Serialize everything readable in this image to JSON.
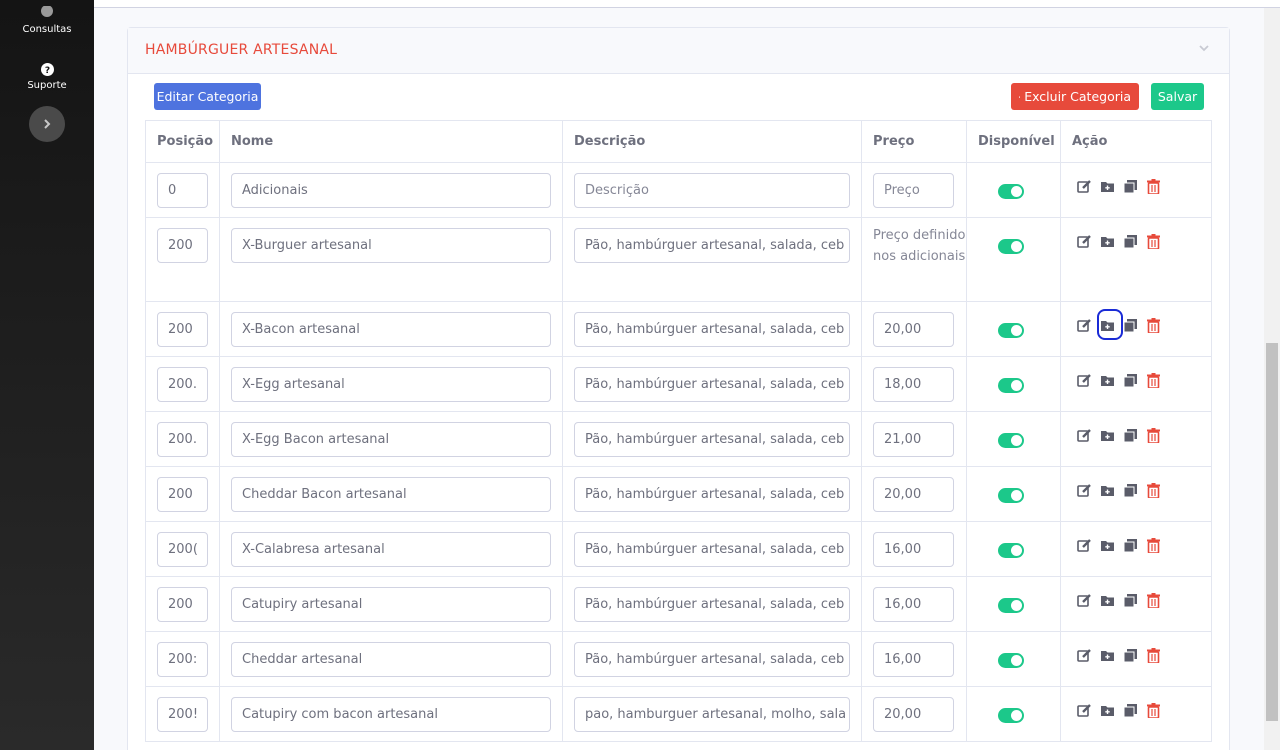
{
  "sidebar": {
    "items": [
      {
        "label": "Consultas",
        "icon": "chart-pie-icon"
      },
      {
        "label": "Suporte",
        "icon": "question-circle-icon"
      }
    ],
    "toggle_icon": "chevron-right-icon"
  },
  "category": {
    "title": "HAMBÚRGUER ARTESANAL",
    "collapse_icon": "chevron-down-icon",
    "edit_label": "Editar Categoria",
    "delete_label": "Excluir Categoria",
    "save_label": "Salvar"
  },
  "table": {
    "headers": [
      "Posição",
      "Nome",
      "Descrição",
      "Preço",
      "Disponível",
      "Ação"
    ],
    "rows": [
      {
        "position": "0",
        "name": "Adicionais",
        "description": "",
        "description_placeholder": "Descrição",
        "price": "",
        "price_placeholder": "Preço",
        "available": true
      },
      {
        "position": "200",
        "name": "X-Burguer artesanal",
        "description": "Pão, hambúrguer artesanal, salada, ceb",
        "price_text": "Preço definido nos adicionais",
        "available": true
      },
      {
        "position": "200",
        "name": "X-Bacon artesanal",
        "description": "Pão, hambúrguer artesanal, salada, ceb",
        "price": "20,00",
        "available": true
      },
      {
        "position": "200.",
        "name": "X-Egg artesanal",
        "description": "Pão, hambúrguer artesanal, salada, ceb",
        "price": "18,00",
        "available": true
      },
      {
        "position": "200.",
        "name": "X-Egg Bacon artesanal",
        "description": "Pão, hambúrguer artesanal, salada, ceb",
        "price": "21,00",
        "available": true
      },
      {
        "position": "200",
        "name": "Cheddar Bacon artesanal",
        "description": "Pão, hambúrguer artesanal, salada, ceb",
        "price": "20,00",
        "available": true
      },
      {
        "position": "200(",
        "name": "X-Calabresa artesanal",
        "description": "Pão, hambúrguer artesanal, salada, ceb",
        "price": "16,00",
        "available": true
      },
      {
        "position": "200",
        "name": "Catupiry artesanal",
        "description": "Pão, hambúrguer artesanal, salada, ceb",
        "price": "16,00",
        "available": true
      },
      {
        "position": "200:",
        "name": "Cheddar artesanal",
        "description": "Pão, hambúrguer artesanal, salada, ceb",
        "price": "16,00",
        "available": true
      },
      {
        "position": "200!",
        "name": "Catupiry com bacon artesanal",
        "description": "pao, hamburguer artesanal, molho, sala",
        "price": "20,00",
        "available": true
      }
    ],
    "action_icons": [
      "edit-icon",
      "folder-plus-icon",
      "copy-icon",
      "trash-icon"
    ]
  },
  "colors": {
    "primary": "#4e73df",
    "danger": "#e74a3b",
    "success": "#1cc88a",
    "annotation": "#1a2bd6"
  }
}
